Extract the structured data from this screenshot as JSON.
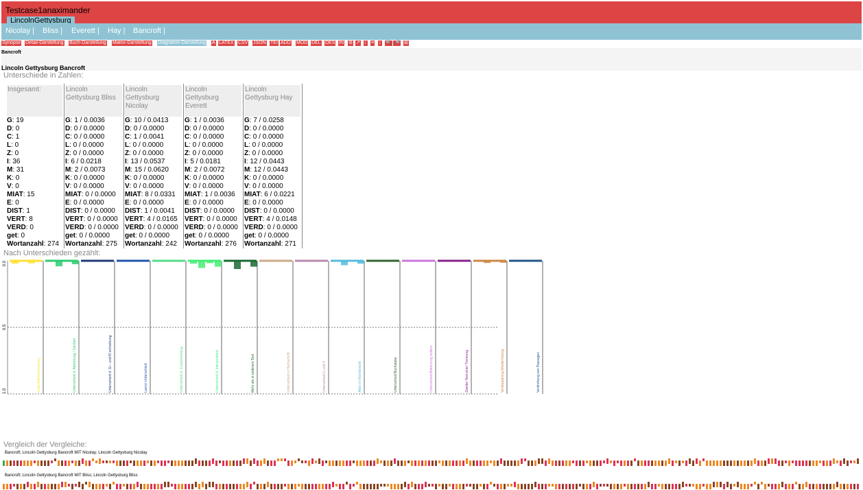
{
  "app": {
    "title": "Testcase1anaximander",
    "active_tab": "LincolnGettysburg"
  },
  "nav": [
    "Nicolay |",
    "Bliss |",
    "Everett |",
    "Hay |",
    "Bancroft |"
  ],
  "views": [
    "Synopse",
    "Detail-Darstellung",
    "Buch-Darstellung",
    "Matrix-Darstellung",
    "Diagramm-Darstellung",
    "A",
    "LATEX",
    "CSV",
    "JSON",
    "TEI",
    "ADD",
    "MOD",
    "DEL",
    "DES",
    "IN",
    "⚙",
    "↗",
    "↕",
    "≡",
    "↕",
    "🔍",
    "🔎",
    "⊞"
  ],
  "active_view": "Diagramm-Darstellung",
  "witness_label": "Bancroft",
  "main_title": "Lincoln Gettysburg Bancroft",
  "stats_heading": "Unterschiede in Zahlen:",
  "stats": [
    {
      "head": "Insgesamt:",
      "rows": [
        [
          "G",
          ": 19"
        ],
        [
          "D",
          ": 0"
        ],
        [
          "C",
          ": 1"
        ],
        [
          "L",
          ": 0"
        ],
        [
          "Z",
          ": 0"
        ],
        [
          "I",
          ": 36"
        ],
        [
          "M",
          ": 31"
        ],
        [
          "K",
          ": 0"
        ],
        [
          "V",
          ": 0"
        ],
        [
          "MIAT",
          ": 15"
        ],
        [
          "E",
          ": 0"
        ],
        [
          "DIST",
          ": 1"
        ],
        [
          "VERT",
          ": 8"
        ],
        [
          "VERD",
          ": 0"
        ],
        [
          "get",
          ": 0"
        ],
        [
          "Wortanzahl",
          ": 274"
        ]
      ]
    },
    {
      "head": "Lincoln Gettysburg Bliss",
      "rows": [
        [
          "G",
          ": 1 / 0.0036"
        ],
        [
          "D",
          ": 0 / 0.0000"
        ],
        [
          "C",
          ": 0 / 0.0000"
        ],
        [
          "L",
          ": 0 / 0.0000"
        ],
        [
          "Z",
          ": 0 / 0.0000"
        ],
        [
          "I",
          ": 6 / 0.0218"
        ],
        [
          "M",
          ": 2 / 0.0073"
        ],
        [
          "K",
          ": 0 / 0.0000"
        ],
        [
          "V",
          ": 0 / 0.0000"
        ],
        [
          "MIAT",
          ": 0 / 0.0000"
        ],
        [
          "E",
          ": 0 / 0.0000"
        ],
        [
          "DIST",
          ": 0 / 0.0000"
        ],
        [
          "VERT",
          ": 0 / 0.0000"
        ],
        [
          "VERD",
          ": 0 / 0.0000"
        ],
        [
          "get",
          ": 0 / 0.0000"
        ],
        [
          "Wortanzahl",
          ": 275"
        ]
      ]
    },
    {
      "head": "Lincoln Gettysburg Nicolay",
      "rows": [
        [
          "G",
          ": 10 / 0.0413"
        ],
        [
          "D",
          ": 0 / 0.0000"
        ],
        [
          "C",
          ": 1 / 0.0041"
        ],
        [
          "L",
          ": 0 / 0.0000"
        ],
        [
          "Z",
          ": 0 / 0.0000"
        ],
        [
          "I",
          ": 13 / 0.0537"
        ],
        [
          "M",
          ": 15 / 0.0620"
        ],
        [
          "K",
          ": 0 / 0.0000"
        ],
        [
          "V",
          ": 0 / 0.0000"
        ],
        [
          "MIAT",
          ": 8 / 0.0331"
        ],
        [
          "E",
          ": 0 / 0.0000"
        ],
        [
          "DIST",
          ": 1 / 0.0041"
        ],
        [
          "VERT",
          ": 4 / 0.0165"
        ],
        [
          "VERD",
          ": 0 / 0.0000"
        ],
        [
          "get",
          ": 0 / 0.0000"
        ],
        [
          "Wortanzahl",
          ": 242"
        ]
      ]
    },
    {
      "head": "Lincoln Gettysburg Everett",
      "rows": [
        [
          "G",
          ": 1 / 0.0036"
        ],
        [
          "D",
          ": 0 / 0.0000"
        ],
        [
          "C",
          ": 0 / 0.0000"
        ],
        [
          "L",
          ": 0 / 0.0000"
        ],
        [
          "Z",
          ": 0 / 0.0000"
        ],
        [
          "I",
          ": 5 / 0.0181"
        ],
        [
          "M",
          ": 2 / 0.0072"
        ],
        [
          "K",
          ": 0 / 0.0000"
        ],
        [
          "V",
          ": 0 / 0.0000"
        ],
        [
          "MIAT",
          ": 1 / 0.0036"
        ],
        [
          "E",
          ": 0 / 0.0000"
        ],
        [
          "DIST",
          ": 0 / 0.0000"
        ],
        [
          "VERT",
          ": 0 / 0.0000"
        ],
        [
          "VERD",
          ": 0 / 0.0000"
        ],
        [
          "get",
          ": 0 / 0.0000"
        ],
        [
          "Wortanzahl",
          ": 276"
        ]
      ]
    },
    {
      "head": "Lincoln Gettysburg Hay",
      "rows": [
        [
          "G",
          ": 7 / 0.0258"
        ],
        [
          "D",
          ": 0 / 0.0000"
        ],
        [
          "C",
          ": 0 / 0.0000"
        ],
        [
          "L",
          ": 0 / 0.0000"
        ],
        [
          "Z",
          ": 0 / 0.0000"
        ],
        [
          "I",
          ": 12 / 0.0443"
        ],
        [
          "M",
          ": 12 / 0.0443"
        ],
        [
          "K",
          ": 0 / 0.0000"
        ],
        [
          "V",
          ": 0 / 0.0000"
        ],
        [
          "MIAT",
          ": 6 / 0.0221"
        ],
        [
          "E",
          ": 0 / 0.0000"
        ],
        [
          "DIST",
          ": 0 / 0.0000"
        ],
        [
          "VERT",
          ": 4 / 0.0148"
        ],
        [
          "VERD",
          ": 0 / 0.0000"
        ],
        [
          "get",
          ": 0 / 0.0000"
        ],
        [
          "Wortanzahl",
          ": 271"
        ]
      ]
    }
  ],
  "chart_heading": "Nach Unterschieden gezählt:",
  "chart_data": {
    "type": "bar",
    "y_ticks": [
      "0.0",
      "0.5",
      "1.0"
    ],
    "ylim": [
      0,
      1
    ],
    "series_order": [
      "Bliss",
      "Nicolay",
      "Everett",
      "Hay"
    ],
    "colors": [
      "#ffe033",
      "#2ecc71",
      "#233a7a",
      "#2255aa",
      "#55dd88",
      "#44ee77",
      "#1a6b35",
      "#ccaa88",
      "#bb88aa",
      "#55bbdd",
      "#336633",
      "#cc77dd",
      "#882288",
      "#cc8844",
      "#225588"
    ],
    "categories": [
      "Groß-/Kleinschreibung",
      "Unterschied d. Abkürzung / Zeichen",
      "Unterschied d. Gr.- und Kl.schreibung",
      "Leerer Unterschied",
      "Unterschied d. Zusammenzug",
      "Unterschied d. Interpunktion",
      "Mehr als in anderem Text",
      "Unterschied in Hochschrift",
      "Unterschied U und V",
      "Alles im Rechtsrecht",
      "Unterschied Buchstabe",
      "Unterschied Abkürzung andere",
      "Zweiter Text einer Trennung",
      "Verdoppelung Wiederholung",
      "Verdrehung von Passagen"
    ],
    "values": [
      [
        0.0218,
        0,
        0.019,
        0
      ],
      [
        0.0036,
        0.0413,
        0.0036,
        0.0258
      ],
      [
        0,
        0,
        0,
        0
      ],
      [
        0,
        0,
        0,
        0
      ],
      [
        0,
        0,
        0,
        0
      ],
      [
        0.0218,
        0.0537,
        0.0181,
        0.0443
      ],
      [
        0,
        0.062,
        0,
        0.0443
      ],
      [
        0,
        0,
        0,
        0
      ],
      [
        0,
        0,
        0,
        0
      ],
      [
        0.0073,
        0.0331,
        0.0072,
        0.0221
      ],
      [
        0,
        0,
        0,
        0
      ],
      [
        0,
        0.0041,
        0,
        0
      ],
      [
        0,
        0,
        0,
        0
      ],
      [
        0,
        0.0165,
        0,
        0.0148
      ],
      [
        0,
        0,
        0,
        0
      ]
    ]
  },
  "compare_heading": "Vergleich der Vergleiche:",
  "compare_rows": [
    "Bancroft; Lincoln Gettysburg Bancroft MIT Nicolay; Lincoln Gettysburg Nicolay",
    "Bancroft; Lincoln Gettysburg Bancroft MIT Bliss; Lincoln Gettysburg Bliss"
  ]
}
